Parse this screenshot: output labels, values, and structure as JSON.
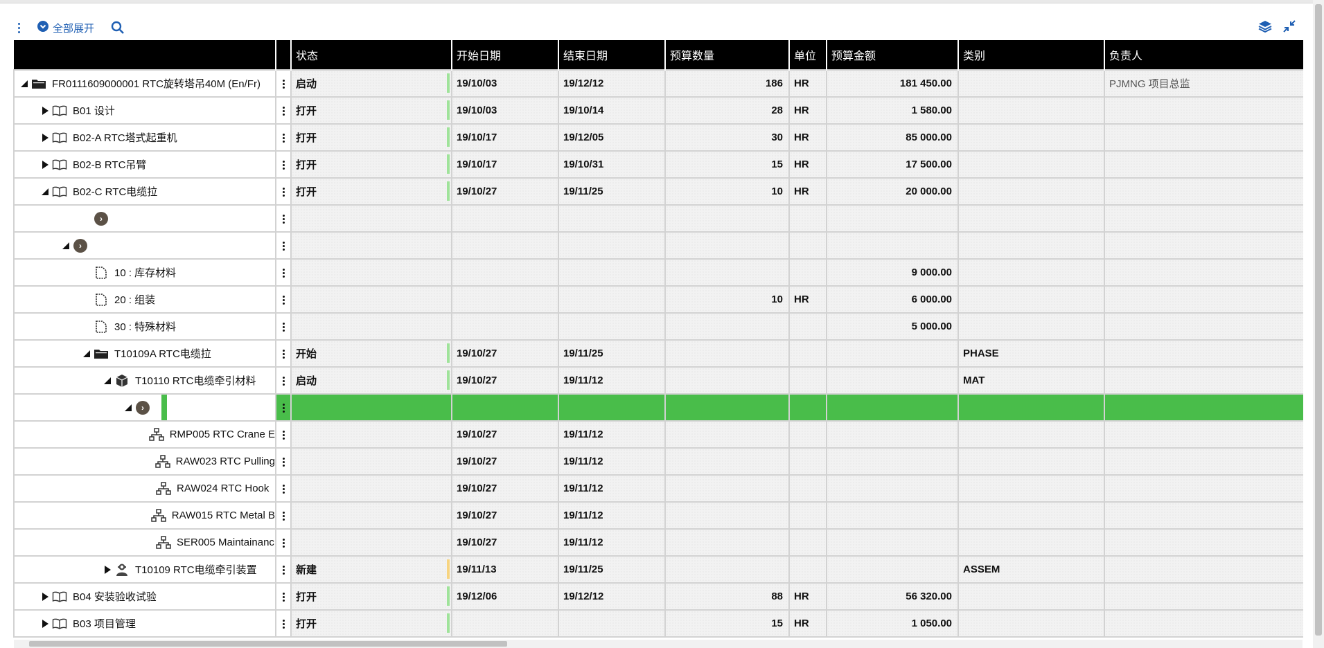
{
  "toolbar": {
    "expand_all_label": "全部展开"
  },
  "columns": [
    "",
    "状态",
    "开始日期",
    "结束日期",
    "预算数量",
    "单位",
    "预算金额",
    "类别",
    "负责人"
  ],
  "rows": [
    {
      "name": "FR0111609000001 RTC旋转塔吊40M (En/Fr)",
      "status": "启动",
      "start": "19/10/03",
      "end": "19/12/12",
      "qty": "186",
      "unit": "HR",
      "amount": "181 450.00",
      "category": "",
      "owner": "PJMNG 项目总监"
    },
    {
      "name": "B01 设计",
      "status": "打开",
      "start": "19/10/03",
      "end": "19/10/14",
      "qty": "28",
      "unit": "HR",
      "amount": "1 580.00",
      "category": "",
      "owner": ""
    },
    {
      "name": "B02-A RTC塔式起重机",
      "status": "打开",
      "start": "19/10/17",
      "end": "19/12/05",
      "qty": "30",
      "unit": "HR",
      "amount": "85 000.00",
      "category": "",
      "owner": ""
    },
    {
      "name": "B02-B RTC吊臂",
      "status": "打开",
      "start": "19/10/17",
      "end": "19/10/31",
      "qty": "15",
      "unit": "HR",
      "amount": "17 500.00",
      "category": "",
      "owner": ""
    },
    {
      "name": "B02-C RTC电缆拉",
      "status": "打开",
      "start": "19/10/27",
      "end": "19/11/25",
      "qty": "10",
      "unit": "HR",
      "amount": "20 000.00",
      "category": "",
      "owner": ""
    },
    {
      "name": "",
      "status": "",
      "start": "",
      "end": "",
      "qty": "",
      "unit": "",
      "amount": "",
      "category": "",
      "owner": ""
    },
    {
      "name": "",
      "status": "",
      "start": "",
      "end": "",
      "qty": "",
      "unit": "",
      "amount": "",
      "category": "",
      "owner": ""
    },
    {
      "name": "10 : 库存材料",
      "status": "",
      "start": "",
      "end": "",
      "qty": "",
      "unit": "",
      "amount": "9 000.00",
      "category": "",
      "owner": ""
    },
    {
      "name": "20 : 组装",
      "status": "",
      "start": "",
      "end": "",
      "qty": "10",
      "unit": "HR",
      "amount": "6 000.00",
      "category": "",
      "owner": ""
    },
    {
      "name": "30 : 特殊材料",
      "status": "",
      "start": "",
      "end": "",
      "qty": "",
      "unit": "",
      "amount": "5 000.00",
      "category": "",
      "owner": ""
    },
    {
      "name": "T10109A RTC电缆拉",
      "status": "开始",
      "start": "19/10/27",
      "end": "19/11/25",
      "qty": "",
      "unit": "",
      "amount": "",
      "category": "PHASE",
      "owner": ""
    },
    {
      "name": "T10110 RTC电缆牵引材料",
      "status": "启动",
      "start": "19/10/27",
      "end": "19/11/12",
      "qty": "",
      "unit": "",
      "amount": "",
      "category": "MAT",
      "owner": ""
    },
    {
      "name": "",
      "status": "",
      "start": "",
      "end": "",
      "qty": "",
      "unit": "",
      "amount": "",
      "category": "",
      "owner": ""
    },
    {
      "name": "RMP005 RTC Crane E",
      "status": "",
      "start": "19/10/27",
      "end": "19/11/12",
      "qty": "",
      "unit": "",
      "amount": "",
      "category": "",
      "owner": ""
    },
    {
      "name": "RAW023 RTC Pulling",
      "status": "",
      "start": "19/10/27",
      "end": "19/11/12",
      "qty": "",
      "unit": "",
      "amount": "",
      "category": "",
      "owner": ""
    },
    {
      "name": "RAW024 RTC Hook",
      "status": "",
      "start": "19/10/27",
      "end": "19/11/12",
      "qty": "",
      "unit": "",
      "amount": "",
      "category": "",
      "owner": ""
    },
    {
      "name": "RAW015 RTC Metal B",
      "status": "",
      "start": "19/10/27",
      "end": "19/11/12",
      "qty": "",
      "unit": "",
      "amount": "",
      "category": "",
      "owner": ""
    },
    {
      "name": "SER005 Maintainanc",
      "status": "",
      "start": "19/10/27",
      "end": "19/11/12",
      "qty": "",
      "unit": "",
      "amount": "",
      "category": "",
      "owner": ""
    },
    {
      "name": "T10109 RTC电缆牵引装置",
      "status": "新建",
      "start": "19/11/13",
      "end": "19/11/25",
      "qty": "",
      "unit": "",
      "amount": "",
      "category": "ASSEM",
      "owner": ""
    },
    {
      "name": "B04 安装验收试验",
      "status": "打开",
      "start": "19/12/06",
      "end": "19/12/12",
      "qty": "88",
      "unit": "HR",
      "amount": "56 320.00",
      "category": "",
      "owner": ""
    },
    {
      "name": "B03 项目管理",
      "status": "打开",
      "start": "",
      "end": "",
      "qty": "15",
      "unit": "HR",
      "amount": "1 050.00",
      "category": "",
      "owner": ""
    }
  ]
}
